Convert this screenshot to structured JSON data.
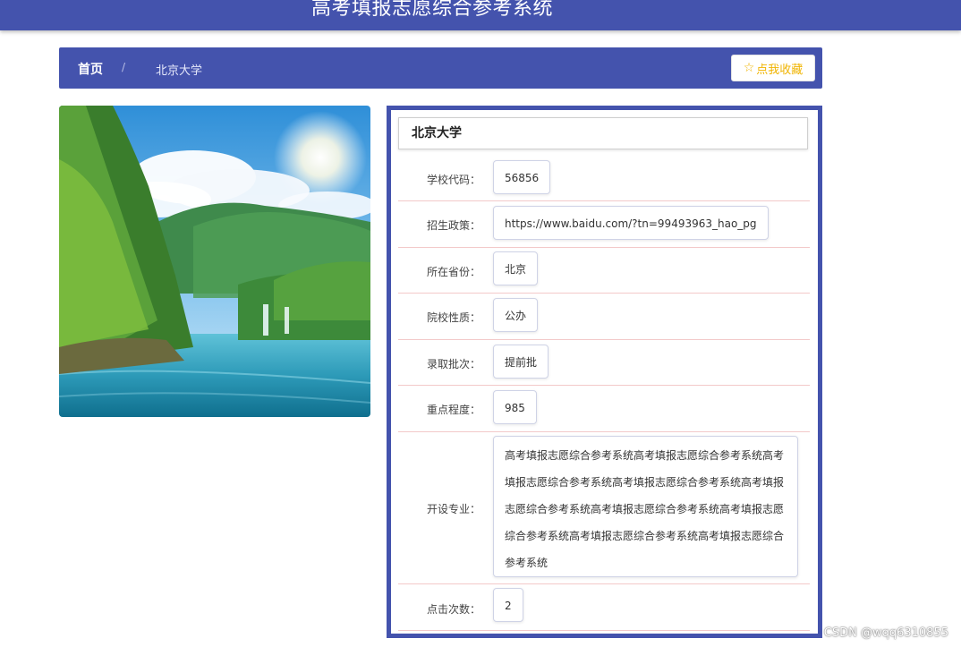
{
  "header": {
    "title": "高考填报志愿综合参考系统"
  },
  "breadcrumb": {
    "home": "首页",
    "separator": "/",
    "current": "北京大学"
  },
  "favorite_button": {
    "icon": "star-outline-icon",
    "label": "点我收藏"
  },
  "school": {
    "name": "北京大学",
    "fields": [
      {
        "label": "学校代码：",
        "value": "56856"
      },
      {
        "label": "招生政策：",
        "value": "https://www.baidu.com/?tn=99493963_hao_pg"
      },
      {
        "label": "所在省份：",
        "value": "北京"
      },
      {
        "label": "院校性质：",
        "value": "公办"
      },
      {
        "label": "录取批次：",
        "value": "提前批"
      },
      {
        "label": "重点程度：",
        "value": "985"
      },
      {
        "label": "开设专业：",
        "value": "高考填报志愿综合参考系统高考填报志愿综合参考系统高考填报志愿综合参考系统高考填报志愿综合参考系统高考填报志愿综合参考系统高考填报志愿综合参考系统高考填报志愿综合参考系统高考填报志愿综合参考系统高考填报志愿综合参考系统"
      },
      {
        "label": "点击次数：",
        "value": "2"
      }
    ]
  },
  "image": {
    "subject": "landscape-lake-forest-photo"
  },
  "watermark": "CSDN @wqq6310855",
  "colors": {
    "primary": "#4453ad",
    "favorite": "#f0b400",
    "row_divider": "#f3c9c9"
  }
}
